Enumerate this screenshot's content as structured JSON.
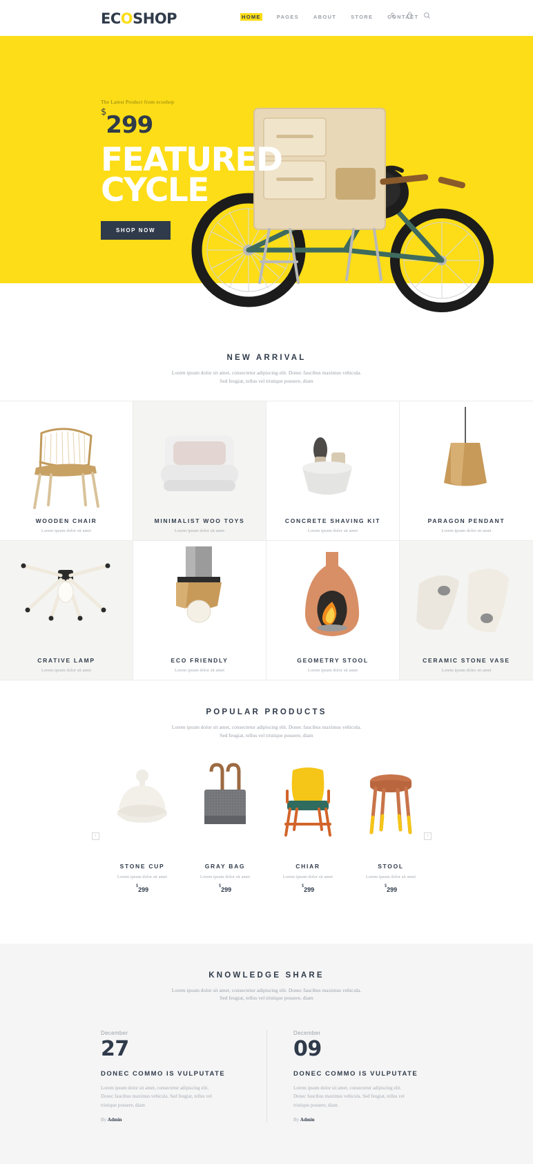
{
  "colors": {
    "accent_yellow": "#fcdd17",
    "dark_navy": "#2f3a4a",
    "muted_text": "#9aa0a8",
    "light_bg": "#f5f5f5"
  },
  "header": {
    "logo": {
      "before": "EC",
      "accent": "O",
      "after": "SHOP"
    },
    "nav": [
      {
        "label": "HOME",
        "active": true
      },
      {
        "label": "PAGES",
        "active": false
      },
      {
        "label": "ABOUT",
        "active": false
      },
      {
        "label": "STORE",
        "active": false
      },
      {
        "label": "CONTACT",
        "active": false
      }
    ],
    "icons": [
      "user-icon",
      "cart-icon",
      "search-icon"
    ]
  },
  "hero": {
    "eyebrow": "The Latest Product from ecoshop",
    "currency": "$",
    "price": "299",
    "title_line1": "FEATURED",
    "title_line2": "CYCLE",
    "button": "SHOP NOW"
  },
  "new_arrival": {
    "title": "NEW ARRIVAL",
    "sub_line1": "Lorem ipsum dolor sit amet, consectetur adipiscing elit. Donec faucibus maximus vehicula.",
    "sub_line2": "Sed feugiat, tellus vel tristique posuere, diam",
    "items": [
      {
        "name": "WOODEN CHAIR",
        "desc": "Lorem ipsum dolor sit amet"
      },
      {
        "name": "MINIMALIST WOO TOYS",
        "desc": "Lorem ipsum dolor sit amet"
      },
      {
        "name": "CONCRETE SHAVING KIT",
        "desc": "Lorem ipsum dolor sit amet"
      },
      {
        "name": "PARAGON PENDANT",
        "desc": "Lorem ipsum dolor sit amet"
      },
      {
        "name": "CRATIVE LAMP",
        "desc": "Lorem ipsum dolor sit amet"
      },
      {
        "name": "ECO FRIENDLY",
        "desc": "Lorem ipsum dolor sit amet"
      },
      {
        "name": "GEOMETRY STOOL",
        "desc": "Lorem ipsum dolor sit amet"
      },
      {
        "name": "CERAMIC STONE VASE",
        "desc": "Lorem ipsum dolor sit amet"
      }
    ]
  },
  "popular": {
    "title": "POPULAR PRODUCTS",
    "sub_line1": "Lorem ipsum dolor sit amet, consectetur adipiscing elit. Donec faucibus maximus vehicula.",
    "sub_line2": "Sed feugiat, tellus vel tristique posuere, diam",
    "prev_label": "‹",
    "next_label": "›",
    "items": [
      {
        "name": "STONE CUP",
        "desc": "Lorem ipsum dolor sit amet",
        "currency": "$",
        "price": "299"
      },
      {
        "name": "GRAY BAG",
        "desc": "Lorem ipsum dolor sit amet",
        "currency": "$",
        "price": "299"
      },
      {
        "name": "CHIAR",
        "desc": "Lorem ipsum dolor sit amet",
        "currency": "$",
        "price": "299"
      },
      {
        "name": "STOOL",
        "desc": "Lorem ipsum dolor sit amet",
        "currency": "$",
        "price": "299"
      }
    ]
  },
  "knowledge": {
    "title": "KNOWLEDGE SHARE",
    "sub_line1": "Lorem ipsum dolor sit amet, consectetur adipiscing elit. Donec faucibus maximus vehicula.",
    "sub_line2": "Sed feugiat, tellus vel tristique posuere, diam",
    "posts": [
      {
        "month": "December",
        "day": "27",
        "title": "DONEC COMMO IS VULPUTATE",
        "excerpt": "Lorem ipsum dolor sit amet, consectetur adipiscing elit. Donec faucibus maximus vehicula. Sed feugiat, tellus vel tristique posuere, diam",
        "by_label": "By",
        "author": "Admin"
      },
      {
        "month": "December",
        "day": "09",
        "title": "DONEC COMMO IS VULPUTATE",
        "excerpt": "Lorem ipsum dolor sit amet, consectetur adipiscing elit. Donec faucibus maximus vehicula. Sed feugiat, tellus vel tristique posuere, diam",
        "by_label": "By",
        "author": "Admin"
      }
    ]
  }
}
